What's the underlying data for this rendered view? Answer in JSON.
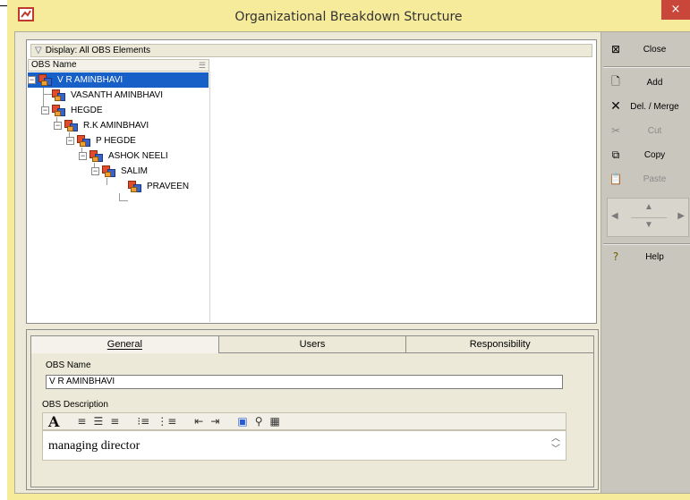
{
  "window": {
    "title": "Organizational Breakdown Structure",
    "close_glyph": "×"
  },
  "tree": {
    "display_label": "Display: All OBS Elements",
    "column_header": "OBS Name",
    "nodes": [
      {
        "label": "V R AMINBHAVI",
        "depth": 0,
        "expander": "−",
        "selected": true
      },
      {
        "label": "VASANTH AMINBHAVI",
        "depth": 1,
        "expander": "",
        "selected": false
      },
      {
        "label": "HEGDE",
        "depth": 1,
        "expander": "−",
        "selected": false
      },
      {
        "label": "R.K AMINBHAVI",
        "depth": 2,
        "expander": "−",
        "selected": false
      },
      {
        "label": "P HEGDE",
        "depth": 3,
        "expander": "−",
        "selected": false
      },
      {
        "label": "ASHOK NEELI",
        "depth": 4,
        "expander": "−",
        "selected": false
      },
      {
        "label": "SALIM",
        "depth": 5,
        "expander": "−",
        "selected": false
      },
      {
        "label": "PRAVEEN",
        "depth": 6,
        "expander": "",
        "selected": false
      }
    ]
  },
  "toolbar": {
    "close": {
      "label": "Close",
      "icon": "close-window-icon"
    },
    "add": {
      "label": "Add",
      "icon": "new-document-icon"
    },
    "delete": {
      "label": "Del. / Merge",
      "icon": "delete-x-icon"
    },
    "cut": {
      "label": "Cut",
      "icon": "scissors-icon",
      "enabled": false
    },
    "copy": {
      "label": "Copy",
      "icon": "copy-icon",
      "enabled": true
    },
    "paste": {
      "label": "Paste",
      "icon": "paste-icon",
      "enabled": false
    },
    "help": {
      "label": "Help",
      "icon": "help-icon"
    }
  },
  "details": {
    "tabs": [
      {
        "label": "General",
        "underline": "G",
        "active": true
      },
      {
        "label": "Users",
        "underline": "U",
        "active": false
      },
      {
        "label": "Responsibility",
        "underline": "R",
        "active": false
      }
    ],
    "obs_name_label": "OBS Name",
    "obs_name_value": "V R AMINBHAVI",
    "obs_description_label": "OBS Description",
    "obs_description_value": "managing director"
  },
  "colors": {
    "title_bar": "#f6ea9b",
    "selection": "#1660c8",
    "close_button": "#c9473a"
  }
}
